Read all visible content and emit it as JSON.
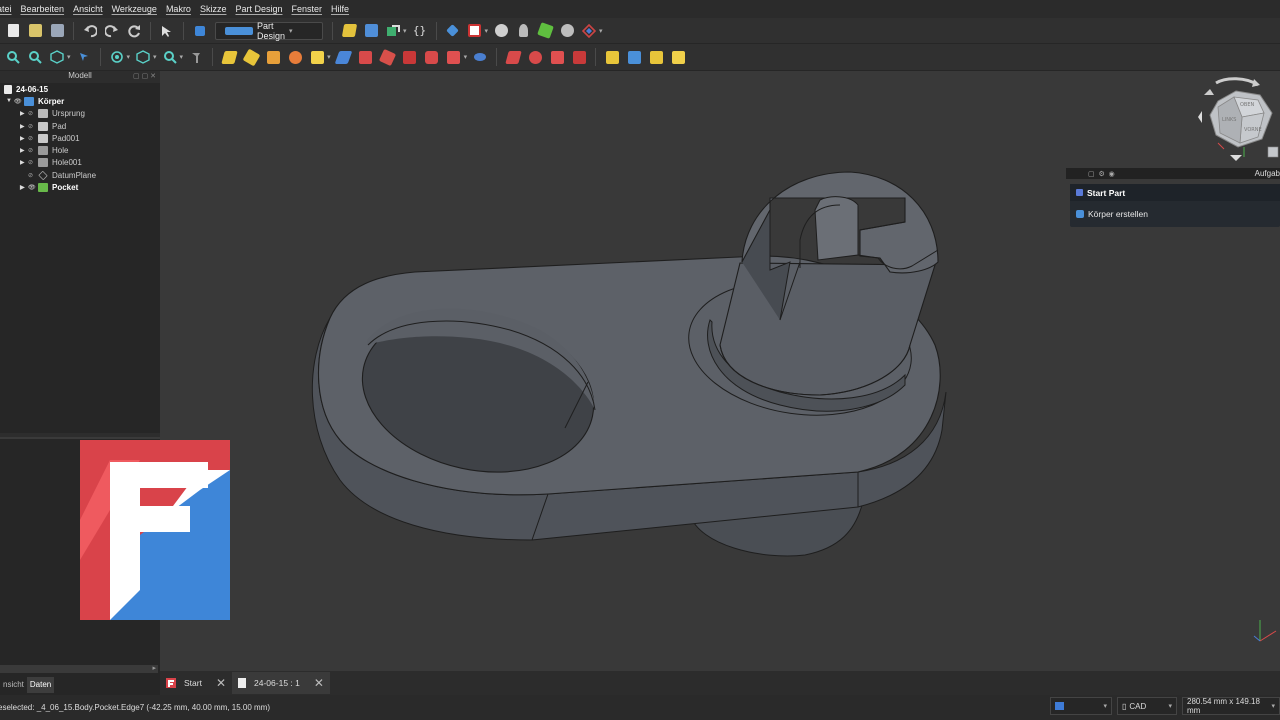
{
  "menu": [
    "atei",
    "Bearbeiten",
    "Ansicht",
    "Werkzeuge",
    "Makro",
    "Skizze",
    "Part Design",
    "Fenster",
    "Hilfe"
  ],
  "toolbar": {
    "workbench": "Part Design",
    "braces": "{}"
  },
  "model_panel": {
    "title": "Modell",
    "document": "24-06-15",
    "tree": [
      {
        "label": "Körper",
        "level": 1,
        "bold": true,
        "expanded": true,
        "icon": "body-icon"
      },
      {
        "label": "Ursprung",
        "level": 2,
        "icon": "origin-icon"
      },
      {
        "label": "Pad",
        "level": 2,
        "icon": "pad-icon"
      },
      {
        "label": "Pad001",
        "level": 2,
        "icon": "pad-icon"
      },
      {
        "label": "Hole",
        "level": 2,
        "icon": "hole-icon"
      },
      {
        "label": "Hole001",
        "level": 2,
        "icon": "hole-icon"
      },
      {
        "label": "DatumPlane",
        "level": 2,
        "icon": "datum-plane-icon"
      },
      {
        "label": "Pocket",
        "level": 2,
        "bold": true,
        "icon": "pocket-icon"
      }
    ],
    "tabs": [
      "nsicht",
      "Daten"
    ]
  },
  "task_panel": {
    "header": "Aufgab",
    "title": "Start Part",
    "item": "Körper erstellen"
  },
  "nav_cube": {
    "faces": [
      "OBEN",
      "VORNE",
      "LINKS"
    ]
  },
  "mdi_tabs": [
    {
      "label": "Start"
    },
    {
      "label": "24-06-15 : 1"
    }
  ],
  "statusbar": {
    "text": "eselected: _4_06_15.Body.Pocket.Edge7 (-42.25 mm, 40.00 mm, 15.00 mm)",
    "nav_style": "CAD",
    "dimensions": "280.54 mm x 149.18 mm"
  },
  "colors": {
    "logo_red": "#d9434a",
    "logo_blue": "#3e86d8",
    "model_grey": "#5b5f66",
    "background": "#393939"
  }
}
